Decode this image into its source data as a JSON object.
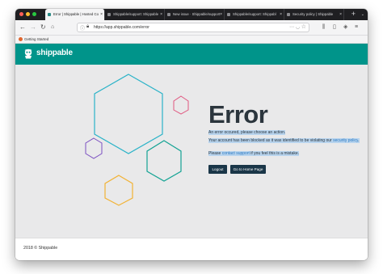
{
  "browser": {
    "tabs": [
      {
        "label": "Error | Shippable | Hosted Co",
        "active": true
      },
      {
        "label": "Shippable/support: Shippable",
        "active": false
      },
      {
        "label": "New issue · Shippable/support",
        "active": false
      },
      {
        "label": "Shippable/support: Shippabl",
        "active": false
      },
      {
        "label": "Security policy | Shippable",
        "active": false
      }
    ],
    "new_tab_symbol": "+",
    "url": "https://app.shippable.com/error",
    "bookmark_label": "Getting Started",
    "traffic_lights": [
      "#ff5f57",
      "#febc2e",
      "#28c840"
    ],
    "icons": [
      "back-icon",
      "forward-icon",
      "reload-icon",
      "home-icon",
      "info-icon",
      "lock-icon",
      "page-actions-icon",
      "pocket-icon",
      "star-icon",
      "library-icon",
      "sidebar-icon",
      "extension-icon",
      "menu-icon"
    ]
  },
  "app": {
    "logo_text": "shippable",
    "brand_color": "#00948a",
    "error_title": "Error",
    "error_intro": "An error occured, please choose an action.",
    "blocked_prefix": "Your account has been blocked as it was identified to be violating our ",
    "blocked_link": "security policy",
    "blocked_suffix": ".",
    "contact_prefix": "Please ",
    "contact_link": "contact support",
    "contact_suffix": " if you feel this is a mistake.",
    "logout_label": "Logout",
    "home_label": "Go to Home Page",
    "footer_text": "2018 © Shippable",
    "hex_colors": {
      "large": "#2bb3c8",
      "pink": "#e0567f",
      "purple": "#7a4ec1",
      "teal": "#14a394",
      "orange": "#f2b233"
    }
  }
}
